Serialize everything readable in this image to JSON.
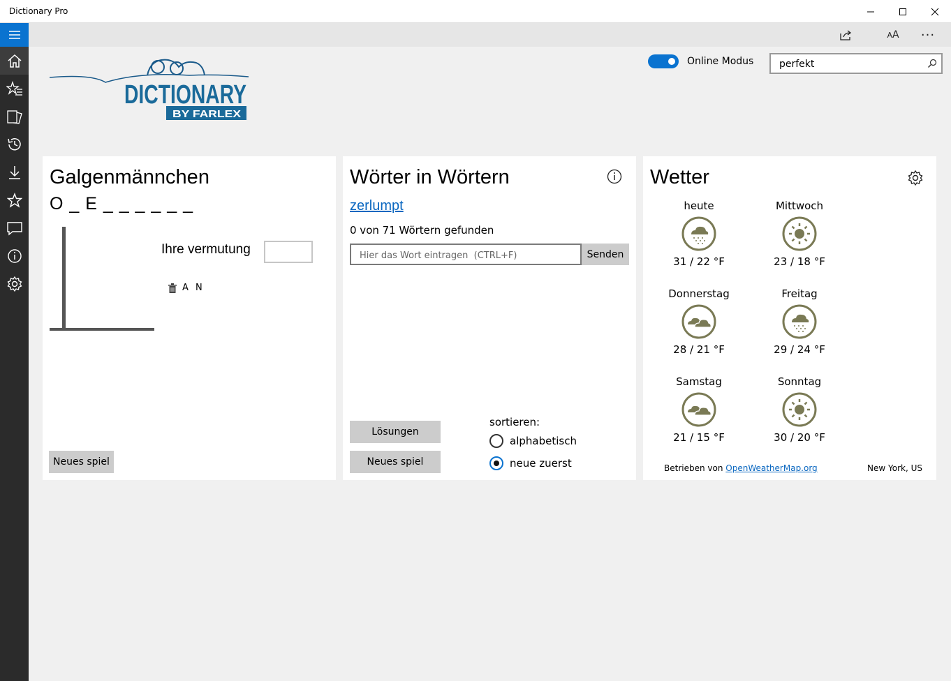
{
  "window": {
    "title": "Dictionary Pro"
  },
  "sidebar": {
    "items": [
      {
        "icon": "hamburger-icon"
      },
      {
        "icon": "home-icon"
      },
      {
        "icon": "star-list-icon"
      },
      {
        "icon": "flashcards-icon"
      },
      {
        "icon": "history-icon"
      },
      {
        "icon": "download-icon"
      },
      {
        "icon": "star-icon"
      },
      {
        "icon": "comment-icon"
      },
      {
        "icon": "info-icon"
      },
      {
        "icon": "settings-icon"
      }
    ]
  },
  "toolbar": {
    "font_label": "AA",
    "more_label": "···"
  },
  "header": {
    "logo": {
      "main": "DICTIONARY",
      "sub": "BY FARLEX"
    },
    "online_mode_label": "Online Modus",
    "online_mode_on": true,
    "search_value": "perfekt"
  },
  "hangman": {
    "title": "Galgenmännchen",
    "pattern": "O _ E _ _ _ _ _ _",
    "guess_label": "Ihre vermutung",
    "wrong_letters": "A N",
    "new_game_label": "Neues spiel"
  },
  "words": {
    "title": "Wörter in Wörtern",
    "word": "zerlumpt",
    "found_text": "0 von 71 Wörtern gefunden",
    "input_placeholder": "Hier das Wort eintragen  (CTRL+F)",
    "send_label": "Senden",
    "solutions_label": "Lösungen",
    "new_game_label": "Neues spiel",
    "sort_label": "sortieren:",
    "sort_options": [
      {
        "label": "alphabetisch",
        "selected": false
      },
      {
        "label": "neue zuerst",
        "selected": true
      }
    ]
  },
  "weather": {
    "title": "Wetter",
    "days": [
      {
        "name": "heute",
        "temp": "31 / 22 °F",
        "icon": "snow-cloud-icon"
      },
      {
        "name": "Mittwoch",
        "temp": "23 / 18 °F",
        "icon": "sun-icon"
      },
      {
        "name": "Donnerstag",
        "temp": "28 / 21 °F",
        "icon": "cloudy-icon"
      },
      {
        "name": "Freitag",
        "temp": "29 / 24 °F",
        "icon": "snow-cloud-icon"
      },
      {
        "name": "Samstag",
        "temp": "21 / 15 °F",
        "icon": "cloudy-icon"
      },
      {
        "name": "Sonntag",
        "temp": "30 / 20 °F",
        "icon": "sun-icon"
      }
    ],
    "powered_by": "Betrieben von",
    "powered_link": "OpenWeatherMap.org",
    "location": "New York, US",
    "icon_color": "#7a7a55"
  }
}
